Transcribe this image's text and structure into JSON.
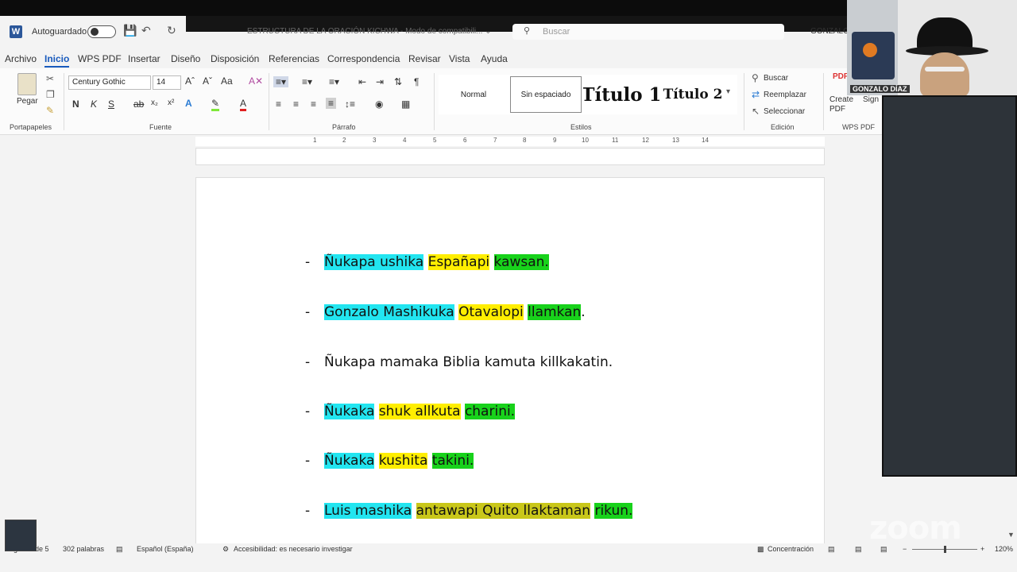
{
  "titlebar": {
    "autosave_label": "Autoguardado",
    "document_title": "ESTRUCTURA DE LA ORACIÓN KICHWA  -  Modo de compatibili...  ⌄",
    "search_placeholder": "Buscar",
    "user": "GONZALO"
  },
  "menu": [
    "Archivo",
    "Inicio",
    "WPS PDF",
    "Insertar",
    "Diseño",
    "Disposición",
    "Referencias",
    "Correspondencia",
    "Revisar",
    "Vista",
    "Ayuda"
  ],
  "ribbon": {
    "paste_label": "Pegar",
    "font_name": "Century Gothic",
    "font_size": "14",
    "bold": "N",
    "italic": "K",
    "underline": "S",
    "groups": {
      "portapapeles": "Portapapeles",
      "fuente": "Fuente",
      "parrafo": "Párrafo",
      "estilos": "Estilos",
      "edicion": "Edición",
      "wps": "WPS PDF"
    },
    "styles": [
      "Normal",
      "Sin espaciado",
      "Título 1",
      "Título 2"
    ],
    "editing": [
      "Buscar",
      "Reemplazar",
      "Seleccionar"
    ],
    "wps_items": [
      "Create PDF",
      "Sign"
    ]
  },
  "ruler_numbers": [
    "1",
    "2",
    "3",
    "4",
    "5",
    "6",
    "7",
    "8",
    "9",
    "10",
    "11",
    "12",
    "13",
    "14"
  ],
  "document": {
    "lines": [
      [
        {
          "t": "Ñukapa ushika",
          "c": "cyan"
        },
        {
          "t": " ",
          "c": ""
        },
        {
          "t": "Españapi",
          "c": "yellow"
        },
        {
          "t": " ",
          "c": ""
        },
        {
          "t": "kawsan.",
          "c": "green"
        }
      ],
      [
        {
          "t": "Gonzalo Mashikuka",
          "c": "cyan"
        },
        {
          "t": " ",
          "c": ""
        },
        {
          "t": "Otavalopi",
          "c": "yellow"
        },
        {
          "t": " ",
          "c": ""
        },
        {
          "t": "llamkan",
          "c": "green"
        },
        {
          "t": ".",
          "c": ""
        }
      ],
      [
        {
          "t": "Ñukapa mamaka Biblia kamuta killkakatin.",
          "c": ""
        }
      ],
      [
        {
          "t": "Ñukaka",
          "c": "cyan"
        },
        {
          "t": " ",
          "c": ""
        },
        {
          "t": "shuk allkuta",
          "c": "yellow"
        },
        {
          "t": " ",
          "c": ""
        },
        {
          "t": "charini.",
          "c": "green"
        }
      ],
      [
        {
          "t": "Ñukaka",
          "c": "cyan"
        },
        {
          "t": " ",
          "c": ""
        },
        {
          "t": "kushita",
          "c": "yellow"
        },
        {
          "t": " ",
          "c": ""
        },
        {
          "t": "takini.",
          "c": "green"
        }
      ],
      [
        {
          "t": "Luis mashika",
          "c": "cyan"
        },
        {
          "t": " ",
          "c": ""
        },
        {
          "t": "antawapi Quito llaktaman",
          "c": "olive"
        },
        {
          "t": " ",
          "c": ""
        },
        {
          "t": "rikun.",
          "c": "green"
        }
      ]
    ]
  },
  "statusbar": {
    "page": "Página 4 de 5",
    "words": "302 palabras",
    "language": "Español (España)",
    "accessibility": "Accesibilidad: es necesario investigar",
    "focus": "Concentración",
    "zoom": "120%"
  },
  "zoom": {
    "participant_name": "GONZALO DÍAZ",
    "watermark": "zoom"
  },
  "colors": {
    "cyan": "#22e5f0",
    "yellow": "#ffee00",
    "green": "#18d21b",
    "olive": "#c9c71a",
    "accent": "#185abd"
  }
}
